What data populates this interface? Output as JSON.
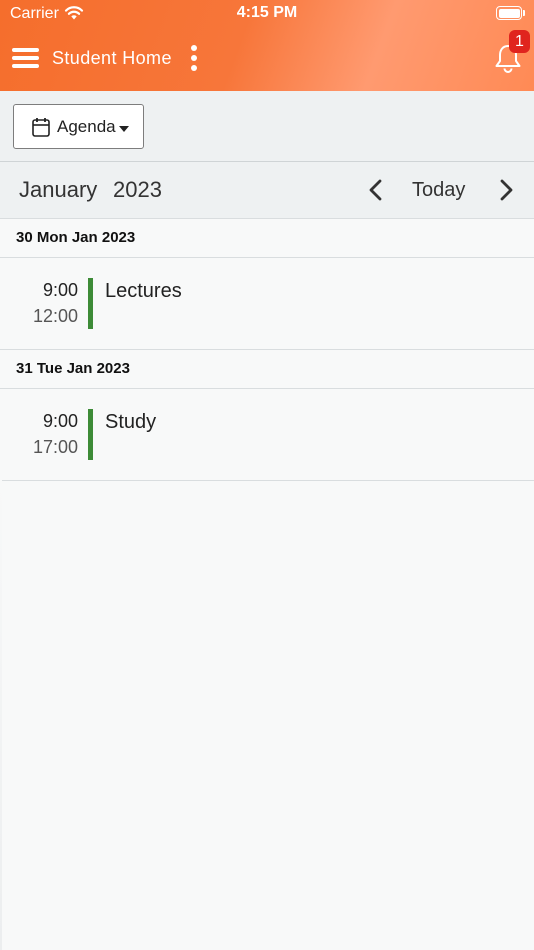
{
  "status_bar": {
    "carrier": "Carrier",
    "time": "4:15 PM"
  },
  "header": {
    "title": "Student Home",
    "notification_count": "1",
    "colors": {
      "primary": "#f56e2c",
      "accent": "#ff9a70",
      "badge": "#e0241e"
    }
  },
  "toolbar": {
    "view_label": "Agenda"
  },
  "calendar_nav": {
    "month": "January",
    "year": "2023",
    "today_label": "Today"
  },
  "days": [
    {
      "header": "30 Mon Jan 2023",
      "events": [
        {
          "start": "9:00",
          "end": "12:00",
          "title": "Lectures",
          "color": "#3d8b37"
        }
      ]
    },
    {
      "header": "31 Tue Jan 2023",
      "events": [
        {
          "start": "9:00",
          "end": "17:00",
          "title": "Study",
          "color": "#3d8b37"
        }
      ]
    }
  ],
  "icons": [
    "wifi-icon",
    "battery-icon",
    "hamburger-menu-icon",
    "more-vertical-icon",
    "bell-icon",
    "calendar-icon",
    "chevron-left-icon",
    "chevron-right-icon"
  ]
}
